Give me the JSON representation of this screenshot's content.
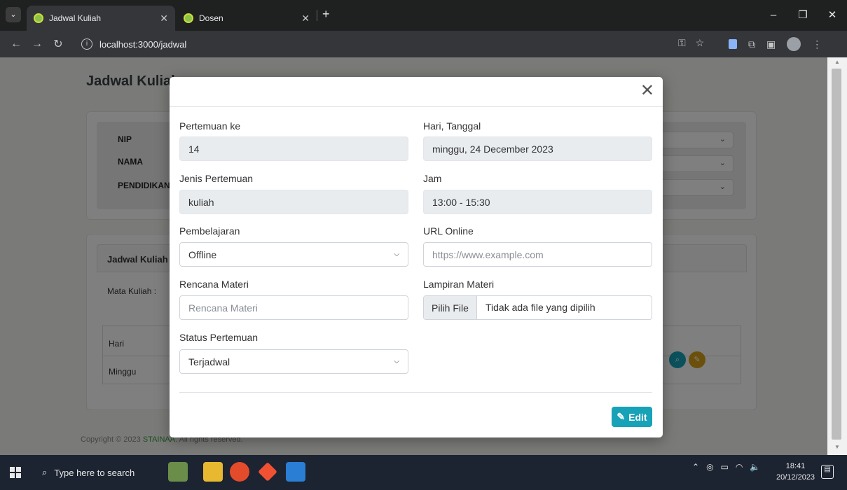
{
  "browser": {
    "tabs": [
      {
        "title": "Jadwal Kuliah",
        "active": true
      },
      {
        "title": "Dosen",
        "active": false
      }
    ],
    "url": "localhost:3000/jadwal"
  },
  "page": {
    "title": "Jadwal Kuliah",
    "filter_labels": [
      "NIP",
      "NAMA",
      "PENDIDIKAN"
    ],
    "card_header": "Jadwal Kuliah",
    "mata_kuliah_label": "Mata Kuliah :",
    "table_header": "Hari",
    "table_row": "Minggu",
    "footer_prefix": "Copyright © 2023 ",
    "footer_brand": "STAINAA",
    "footer_suffix": ". All rights reserved."
  },
  "modal": {
    "pertemuan_label": "Pertemuan ke",
    "pertemuan_value": "14",
    "hari_label": "Hari, Tanggal",
    "hari_value": "minggu, 24 December 2023",
    "jenis_label": "Jenis Pertemuan",
    "jenis_value": "kuliah",
    "jam_label": "Jam",
    "jam_value": "13:00 - 15:30",
    "pembelajaran_label": "Pembelajaran",
    "pembelajaran_value": "Offline",
    "url_label": "URL Online",
    "url_placeholder": "https://www.example.com",
    "rencana_label": "Rencana Materi",
    "rencana_placeholder": "Rencana Materi",
    "lampiran_label": "Lampiran Materi",
    "file_button": "Pilih File",
    "file_status": "Tidak ada file yang dipilih",
    "status_label": "Status Pertemuan",
    "status_value": "Terjadwal",
    "edit_label": "Edit"
  },
  "taskbar": {
    "search_placeholder": "Type here to search",
    "time": "18:41",
    "date": "20/12/2023"
  },
  "colors": {
    "accent_teal": "#17a2b8",
    "accent_yellow": "#d4a017",
    "brand_green": "#3c9d3c"
  }
}
